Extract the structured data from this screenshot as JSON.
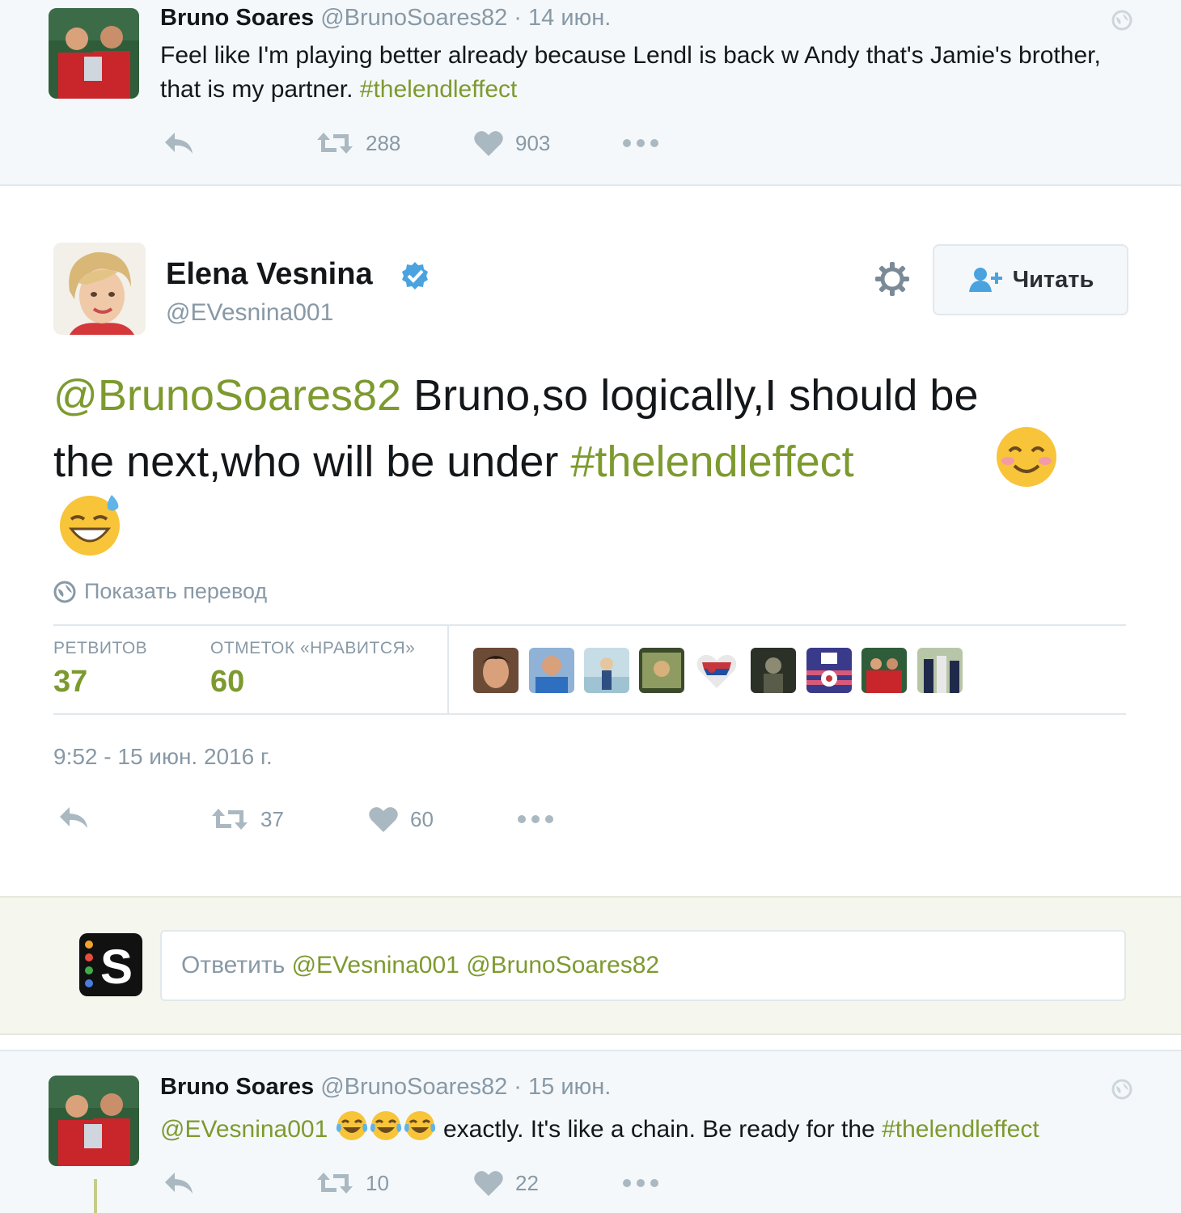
{
  "top_tweet": {
    "name": "Bruno Soares",
    "handle": "@BrunoSoares82",
    "separator": "·",
    "date": "14 июн.",
    "text_prefix": "Feel like I'm playing better already because Lendl is back w Andy that's Jamie's brother, that is my partner.",
    "hashtag": "#thelendleffect",
    "retweets": "288",
    "likes": "903",
    "avatar_icon": "player-photo"
  },
  "main_tweet": {
    "name": "Elena Vesnina",
    "handle": "@EVesnina001",
    "verified_icon": "verified-badge-icon",
    "follow_label": "Читать",
    "mention": "@BrunoSoares82",
    "text_line1": " Bruno,so logically,I should be",
    "text_line2": "the next,who will be under ",
    "hashtag": "#thelendleffect",
    "emojis": [
      "smiling-face-emoji",
      "grinning-sweat-emoji"
    ],
    "translate_label": "Показать перевод",
    "retweets_label": "РЕТВИТОВ",
    "retweets_count": "37",
    "likes_label": "ОТМЕТОК «НРАВИТСЯ»",
    "likes_count": "60",
    "likers": [
      "liker-1",
      "liker-2",
      "liker-3",
      "liker-4",
      "liker-5",
      "liker-6",
      "liker-7",
      "liker-8",
      "liker-9"
    ],
    "timestamp": "9:52 - 15 июн. 2016 г.",
    "action_retweets": "37",
    "action_likes": "60"
  },
  "reply_bar": {
    "prefix": "Ответить",
    "mentions": "@EVesnina001 @BrunoSoares82",
    "app_icon": "s-app-icon"
  },
  "bottom_tweet": {
    "name": "Bruno Soares",
    "handle": "@BrunoSoares82",
    "separator": "·",
    "date": "15 июн.",
    "mention": "@EVesnina001",
    "emojis": [
      "tears-of-joy-emoji",
      "tears-of-joy-emoji",
      "tears-of-joy-emoji"
    ],
    "text": " exactly. It's like a chain. Be ready for the ",
    "hashtag": "#thelendleffect",
    "retweets": "10",
    "likes": "22"
  },
  "colors": {
    "accent_green": "#7d9a2f",
    "muted": "#8899a6",
    "verified_blue": "#4aa3df",
    "panel_bg": "#f5f8fa"
  }
}
